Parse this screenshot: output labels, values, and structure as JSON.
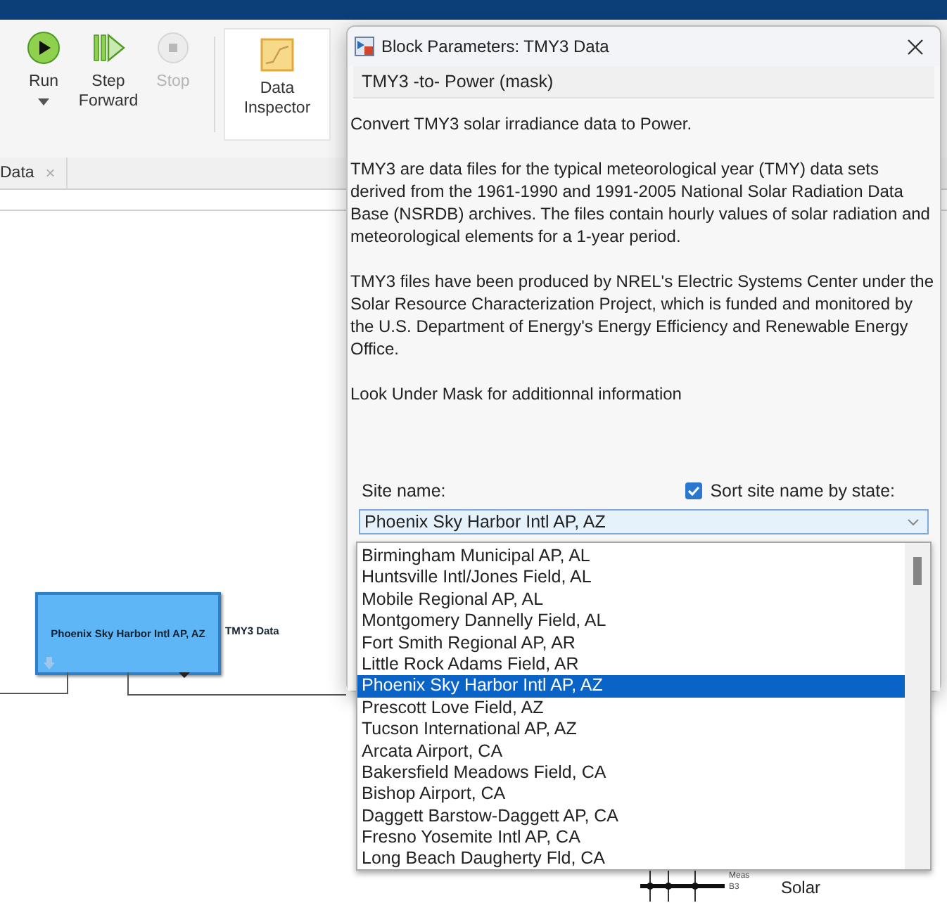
{
  "toolstrip": {
    "buttons": [
      {
        "label": "Run",
        "kind": "run",
        "disabled": false,
        "has_menu": true
      },
      {
        "label": "Step Forward",
        "kind": "step",
        "disabled": false,
        "has_menu": false
      },
      {
        "label": "Stop",
        "kind": "stop",
        "disabled": true,
        "has_menu": false
      },
      {
        "label": "Data Inspector",
        "kind": "inspector",
        "disabled": false,
        "has_menu": false
      }
    ]
  },
  "document_tabs": [
    {
      "label": "Data",
      "close": "×"
    }
  ],
  "canvas": {
    "block": {
      "label": "Phoenix Sky Harbor Intl AP, AZ",
      "name": "TMY3 Data"
    },
    "bus": {
      "port_label": "Meas",
      "port_sublabel": "B3",
      "name": "Solar"
    }
  },
  "dialog": {
    "title": "Block Parameters: TMY3 Data",
    "mask_title": "TMY3 -to- Power (mask)",
    "paragraphs": [
      "Convert TMY3 solar irradiance data to Power.",
      "TMY3 are data files for the typical meteorological year (TMY) data sets derived from the 1961-1990 and 1991-2005 National Solar Radiation Data Base (NSRDB) archives. The files contain hourly values of solar radiation and meteorological elements for a 1-year period.",
      "TMY3 files have been produced by NREL's Electric Systems Center under the Solar Resource Characterization Project, which is funded and monitored by the U.S. Department of Energy's Energy Efficiency and Renewable Energy Office.",
      "Look Under Mask for additionnal information"
    ],
    "site_name_label": "Site name:",
    "sort_checkbox": {
      "label": "Sort site name by state:",
      "checked": true
    },
    "site_dropdown": {
      "value": "Phoenix Sky Harbor Intl AP, AZ",
      "options": [
        {
          "label": "Birmingham Municipal AP, AL",
          "selected": false
        },
        {
          "label": "Huntsville Intl/Jones Field, AL",
          "selected": false
        },
        {
          "label": "Mobile Regional AP, AL",
          "selected": false
        },
        {
          "label": "Montgomery Dannelly Field, AL",
          "selected": false
        },
        {
          "label": "Fort Smith Regional AP, AR",
          "selected": false
        },
        {
          "label": "Little Rock Adams Field, AR",
          "selected": false
        },
        {
          "label": "Phoenix Sky Harbor Intl AP, AZ",
          "selected": true
        },
        {
          "label": "Prescott Love Field, AZ",
          "selected": false
        },
        {
          "label": "Tucson International AP, AZ",
          "selected": false
        },
        {
          "label": "Arcata Airport, CA",
          "selected": false
        },
        {
          "label": "Bakersfield Meadows Field, CA",
          "selected": false
        },
        {
          "label": "Bishop Airport, CA",
          "selected": false
        },
        {
          "label": "Daggett Barstow-Daggett AP, CA",
          "selected": false
        },
        {
          "label": "Fresno Yosemite Intl AP, CA",
          "selected": false
        },
        {
          "label": "Long Beach Daugherty Fld, CA",
          "selected": false
        }
      ]
    }
  }
}
